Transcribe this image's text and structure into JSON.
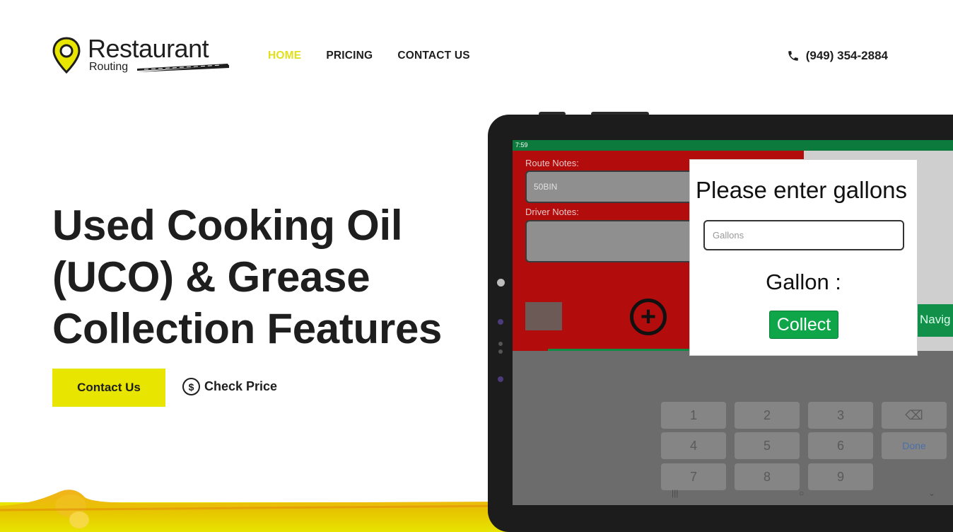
{
  "header": {
    "logo": {
      "word": "Restaurant",
      "sub": "Routing"
    },
    "nav": [
      {
        "label": "HOME",
        "active": true
      },
      {
        "label": "PRICING",
        "active": false
      },
      {
        "label": "CONTACT US",
        "active": false
      }
    ],
    "phone": "(949) 354-2884"
  },
  "hero": {
    "title_line1": "Used Cooking Oil",
    "title_line2": "(UCO) & Grease",
    "title_line3": "Collection Features",
    "cta_label": "Contact Us",
    "price_link": "Check Price",
    "price_icon": "$"
  },
  "app_screen": {
    "status_time": "7:59",
    "route_notes_label": "Route Notes:",
    "route_notes_value": "50BIN",
    "driver_notes_label": "Driver Notes:",
    "nav_button": "Navig",
    "dialog": {
      "title": "Please enter gallons",
      "input_placeholder": "Gallons",
      "gallon_label": "Gallon :",
      "collect_label": "Collect"
    },
    "keypad": [
      "1",
      "2",
      "3",
      "4",
      "5",
      "6",
      "7",
      "8",
      "9"
    ],
    "keypad_done": "Done"
  },
  "colors": {
    "accent": "#e8e500",
    "nav_active": "#e2df1b",
    "app_red": "#b20c0c",
    "app_green": "#0fa64a",
    "text": "#1e1e1e"
  },
  "icons": [
    "logo-pin-icon",
    "phone-icon",
    "dollar-icon",
    "plus-icon",
    "backspace-icon"
  ]
}
